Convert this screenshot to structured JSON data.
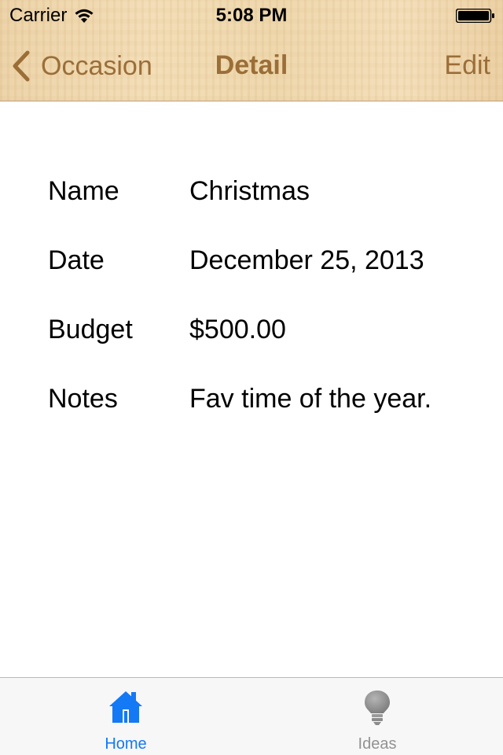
{
  "status_bar": {
    "carrier": "Carrier",
    "time": "5:08 PM",
    "wifi_icon": "wifi-icon",
    "battery_icon": "battery-icon"
  },
  "nav": {
    "back_label": "Occasion",
    "back_icon": "chevron-left-icon",
    "title": "Detail",
    "edit_label": "Edit"
  },
  "detail": {
    "rows": [
      {
        "label": "Name",
        "value": "Christmas"
      },
      {
        "label": "Date",
        "value": "December 25, 2013"
      },
      {
        "label": "Budget",
        "value": "$500.00"
      },
      {
        "label": "Notes",
        "value": "Fav time of the year."
      }
    ]
  },
  "tab_bar": {
    "tabs": [
      {
        "label": "Home",
        "icon": "home-icon",
        "selected": true
      },
      {
        "label": "Ideas",
        "icon": "lightbulb-icon",
        "selected": false
      }
    ]
  },
  "colors": {
    "accent": "#9b6e38",
    "tab_selected": "#1479f5",
    "tab_unselected": "#929292",
    "header_wood": "#f0d8ae"
  }
}
